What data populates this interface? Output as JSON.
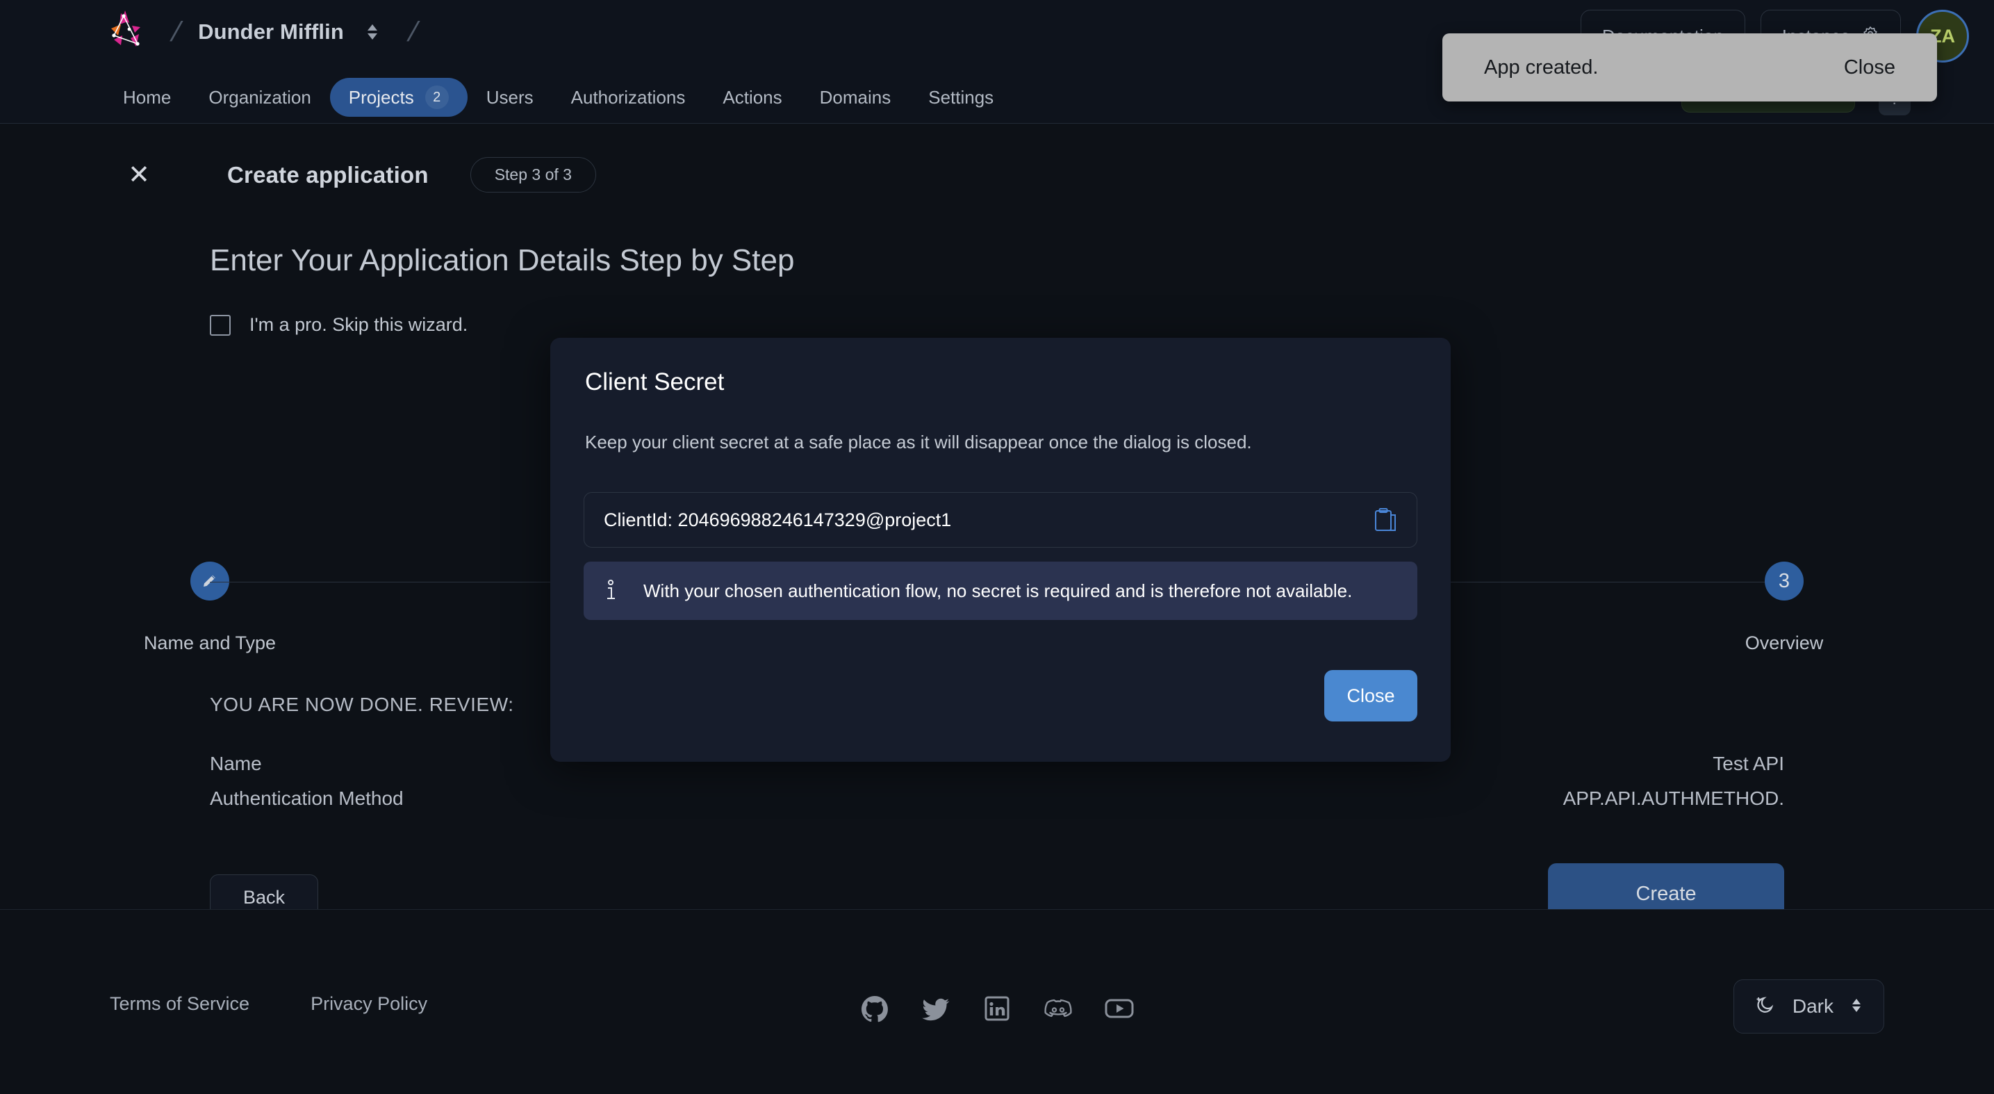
{
  "header": {
    "org_name": "Dunder Mifflin",
    "logo_icon": "zitadel-logo-icon",
    "org_switch_icon": "chevron-up-down-icon",
    "nav": [
      {
        "label": "Home",
        "active": false,
        "badge": null
      },
      {
        "label": "Organization",
        "active": false,
        "badge": null
      },
      {
        "label": "Projects",
        "active": true,
        "badge": "2"
      },
      {
        "label": "Users",
        "active": false,
        "badge": null
      },
      {
        "label": "Authorizations",
        "active": false,
        "badge": null
      },
      {
        "label": "Actions",
        "active": false,
        "badge": null
      },
      {
        "label": "Domains",
        "active": false,
        "badge": null
      },
      {
        "label": "Settings",
        "active": false,
        "badge": null
      }
    ],
    "documentation_label": "Documentation",
    "instance_label": "Instance",
    "instance_icon": "gear-icon",
    "avatar_initials": "ZA",
    "help_label": "?"
  },
  "toast": {
    "message": "App created.",
    "close_label": "Close"
  },
  "wizard": {
    "close_icon": "close-icon",
    "title": "Create application",
    "step_pill": "Step 3 of 3",
    "heading": "Enter Your Application Details Step by Step",
    "skip_label": "I'm a pro. Skip this wizard.",
    "skip_checked": false,
    "steps": [
      {
        "marker": "✎",
        "marker_kind": "pencil-icon",
        "label": "Name and Type"
      },
      {
        "marker": "3",
        "marker_kind": "number",
        "label": "Overview"
      }
    ],
    "review_heading": "YOU ARE NOW DONE. REVIEW:",
    "review_rows": [
      {
        "key": "Name",
        "value": "Test API"
      },
      {
        "key": "Authentication Method",
        "value": "APP.API.AUTHMETHOD."
      }
    ],
    "back_label": "Back",
    "create_label": "Create"
  },
  "dialog": {
    "title": "Client Secret",
    "subtitle": "Keep your client secret at a safe place as it will disappear once the dialog is closed.",
    "client_id_text": "ClientId: 204696988246147329@project1",
    "copy_icon": "copy-clipboard-icon",
    "info_icon": "info-icon",
    "info_text": "With your chosen authentication flow, no secret is required and is therefore not available.",
    "close_label": "Close"
  },
  "footer": {
    "links": [
      {
        "label": "Terms of Service"
      },
      {
        "label": "Privacy Policy"
      }
    ],
    "socials": [
      {
        "name": "github-icon"
      },
      {
        "name": "twitter-icon"
      },
      {
        "name": "linkedin-icon"
      },
      {
        "name": "discord-icon"
      },
      {
        "name": "youtube-icon"
      }
    ],
    "theme_label": "Dark",
    "theme_icon": "moon-icon",
    "theme_switch_icon": "chevron-up-down-icon"
  },
  "colors": {
    "background": "#0d1117",
    "accent_blue": "#2e5e9e",
    "primary_button": "#2c5185",
    "dialog_button": "#4a88d0",
    "info_banner": "#2b3350",
    "toast_bg": "#b4b4b4"
  }
}
